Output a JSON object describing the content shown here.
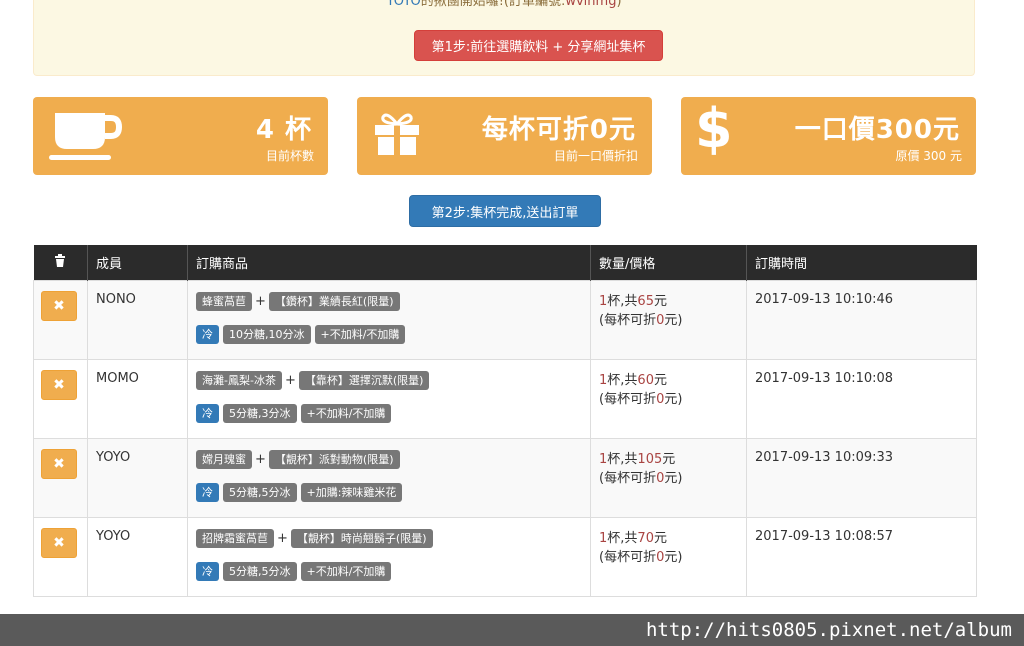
{
  "banner": {
    "name": "YOYO",
    "text_mid": "的揪團開始囉!(訂單編號:",
    "order_code": "wvlnmg",
    "text_end": ")",
    "step1_label": "第1步:前往選購飲料 + 分享網址集杯"
  },
  "cards": [
    {
      "icon": "coffee-cup-icon",
      "big": "4 杯",
      "small": "目前杯數"
    },
    {
      "icon": "gift-icon",
      "big": "每杯可折0元",
      "small": "目前一口價折扣"
    },
    {
      "icon": "dollar-icon",
      "big": "一口價300元",
      "small": "原價 300 元"
    }
  ],
  "step2_label": "第2步:集杯完成,送出訂單",
  "table": {
    "headers": {
      "delete_icon": "trash-icon",
      "member": "成員",
      "items": "訂購商品",
      "qty_price": "數量/價格",
      "time": "訂購時間"
    },
    "rows": [
      {
        "member": "NONO",
        "drink": "蜂蜜萵苣",
        "cup": "【鑽杯】業績長紅(限量)",
        "temp": "冷",
        "sugar_ice": "10分糖,10分冰",
        "addon": "+不加料/不加購",
        "qty": "1",
        "qty_text": "杯,共",
        "price": "65",
        "price_unit": "元",
        "discount_pre": "(每杯可折",
        "discount": "0",
        "discount_post": "元)",
        "time": "2017-09-13 10:10:46"
      },
      {
        "member": "MOMO",
        "drink": "海灘-鳳梨-冰茶",
        "cup": "【靠杯】選擇沉默(限量)",
        "temp": "冷",
        "sugar_ice": "5分糖,3分冰",
        "addon": "+不加料/不加購",
        "qty": "1",
        "qty_text": "杯,共",
        "price": "60",
        "price_unit": "元",
        "discount_pre": "(每杯可折",
        "discount": "0",
        "discount_post": "元)",
        "time": "2017-09-13 10:10:08"
      },
      {
        "member": "YOYO",
        "drink": "嫦月瑰蜜",
        "cup": "【靚杯】派對動物(限量)",
        "temp": "冷",
        "sugar_ice": "5分糖,5分冰",
        "addon": "+加購:辣味雞米花",
        "qty": "1",
        "qty_text": "杯,共",
        "price": "105",
        "price_unit": "元",
        "discount_pre": "(每杯可折",
        "discount": "0",
        "discount_post": "元)",
        "time": "2017-09-13 10:09:33"
      },
      {
        "member": "YOYO",
        "drink": "招牌霜蜜萵苣",
        "cup": "【靚杯】時尚翹鬍子(限量)",
        "temp": "冷",
        "sugar_ice": "5分糖,5分冰",
        "addon": "+不加料/不加購",
        "qty": "1",
        "qty_text": "杯,共",
        "price": "70",
        "price_unit": "元",
        "discount_pre": "(每杯可折",
        "discount": "0",
        "discount_post": "元)",
        "time": "2017-09-13 10:08:57"
      }
    ],
    "row_delete_icon": "close-icon",
    "plus_sign": "+"
  },
  "watermark": "http://hits0805.pixnet.net/album"
}
